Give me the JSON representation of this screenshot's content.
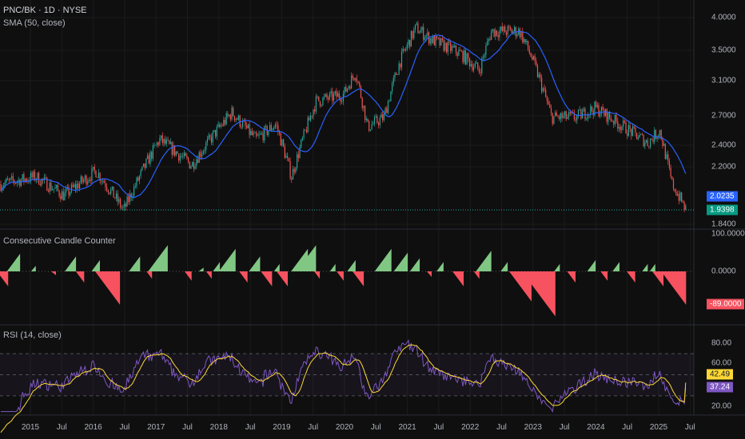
{
  "header": {
    "symbol": "PNC/BK · 1D · NYSE",
    "sma_label": "SMA (50, close)"
  },
  "panes": {
    "ccc_title": "Consecutive Candle Counter",
    "rsi_title": "RSI (14, close)"
  },
  "price_axis": {
    "ticks": [
      "4.0000",
      "3.5000",
      "3.1000",
      "2.7000",
      "2.4000",
      "2.2000",
      "1.8400"
    ],
    "sma_value": "2.0235",
    "last_price": "1.9398"
  },
  "ccc_axis": {
    "ticks": [
      "100.0000",
      "0.0000"
    ],
    "last_value": "-89.0000"
  },
  "rsi_axis": {
    "ticks": [
      "80.00",
      "60.00",
      "20.00"
    ],
    "rsi_ma_value": "42.49",
    "rsi_value": "37.24"
  },
  "time_axis": [
    "2015",
    "Jul",
    "2016",
    "Jul",
    "2017",
    "Jul",
    "2018",
    "Jul",
    "2019",
    "Jul",
    "2020",
    "Jul",
    "2021",
    "Jul",
    "2022",
    "Jul",
    "2023",
    "Jul",
    "2024",
    "Jul",
    "2025",
    "Jul"
  ],
  "colors": {
    "up": "#26a69a",
    "down": "#ef5350",
    "sma": "#2962ff",
    "ccc_up": "#81c784",
    "ccc_down": "#f7525f",
    "rsi": "#7e57c2",
    "rsi_ma": "#fdd835"
  },
  "chart_data": {
    "type": "candlestick",
    "title": "PNC/BK · 1D · NYSE",
    "price_scale": "log",
    "ylim": [
      1.84,
      4.0
    ],
    "xlim": [
      2014.52,
      2025.55
    ],
    "price": [
      [
        2014.52,
        2.14
      ],
      [
        2015.09,
        2.2
      ],
      [
        2015.54,
        2.05
      ],
      [
        2016.05,
        2.25
      ],
      [
        2016.49,
        1.94
      ],
      [
        2017.06,
        2.53
      ],
      [
        2017.57,
        2.3
      ],
      [
        2018.21,
        2.8
      ],
      [
        2018.59,
        2.53
      ],
      [
        2018.91,
        2.68
      ],
      [
        2019.16,
        2.2
      ],
      [
        2019.55,
        2.92
      ],
      [
        2019.99,
        3.0
      ],
      [
        2020.18,
        3.26
      ],
      [
        2020.37,
        2.65
      ],
      [
        2020.63,
        2.75
      ],
      [
        2020.88,
        3.38
      ],
      [
        2021.14,
        3.85
      ],
      [
        2021.39,
        3.68
      ],
      [
        2021.84,
        3.5
      ],
      [
        2022.15,
        3.28
      ],
      [
        2022.34,
        3.8
      ],
      [
        2022.79,
        3.8
      ],
      [
        2022.98,
        3.45
      ],
      [
        2023.3,
        2.75
      ],
      [
        2023.68,
        2.75
      ],
      [
        2024.0,
        2.85
      ],
      [
        2024.38,
        2.68
      ],
      [
        2024.83,
        2.5
      ],
      [
        2025.02,
        2.62
      ],
      [
        2025.21,
        2.15
      ],
      [
        2025.44,
        1.94
      ]
    ],
    "ccc_peaks": [
      [
        2014.65,
        -40
      ],
      [
        2014.84,
        47
      ],
      [
        2015.09,
        15
      ],
      [
        2015.41,
        -10
      ],
      [
        2015.73,
        40
      ],
      [
        2015.86,
        -30
      ],
      [
        2016.11,
        30
      ],
      [
        2016.43,
        -89
      ],
      [
        2016.75,
        40
      ],
      [
        2016.94,
        -20
      ],
      [
        2017.19,
        70
      ],
      [
        2017.57,
        -25
      ],
      [
        2017.76,
        10
      ],
      [
        2017.89,
        -20
      ],
      [
        2018.02,
        25
      ],
      [
        2018.27,
        60
      ],
      [
        2018.46,
        -30
      ],
      [
        2018.66,
        40
      ],
      [
        2018.85,
        -40
      ],
      [
        2018.97,
        20
      ],
      [
        2019.1,
        -40
      ],
      [
        2019.42,
        60
      ],
      [
        2019.55,
        70
      ],
      [
        2019.61,
        -20
      ],
      [
        2019.86,
        20
      ],
      [
        2019.99,
        -25
      ],
      [
        2020.18,
        30
      ],
      [
        2020.31,
        -40
      ],
      [
        2020.75,
        60
      ],
      [
        2021.01,
        50
      ],
      [
        2021.2,
        35
      ],
      [
        2021.39,
        -15
      ],
      [
        2021.58,
        25
      ],
      [
        2021.9,
        -40
      ],
      [
        2022.15,
        -20
      ],
      [
        2022.34,
        55
      ],
      [
        2022.6,
        25
      ],
      [
        2022.98,
        -80
      ],
      [
        2023.36,
        -120
      ],
      [
        2023.43,
        20
      ],
      [
        2023.68,
        -30
      ],
      [
        2024.0,
        30
      ],
      [
        2024.19,
        -25
      ],
      [
        2024.38,
        25
      ],
      [
        2024.63,
        -30
      ],
      [
        2024.83,
        20
      ],
      [
        2024.95,
        20
      ],
      [
        2025.08,
        -40
      ],
      [
        2025.44,
        -89
      ]
    ],
    "rsi_levels": [
      70,
      50,
      30
    ],
    "rsi_last": 37.24,
    "rsi_ma_last": 42.49
  }
}
